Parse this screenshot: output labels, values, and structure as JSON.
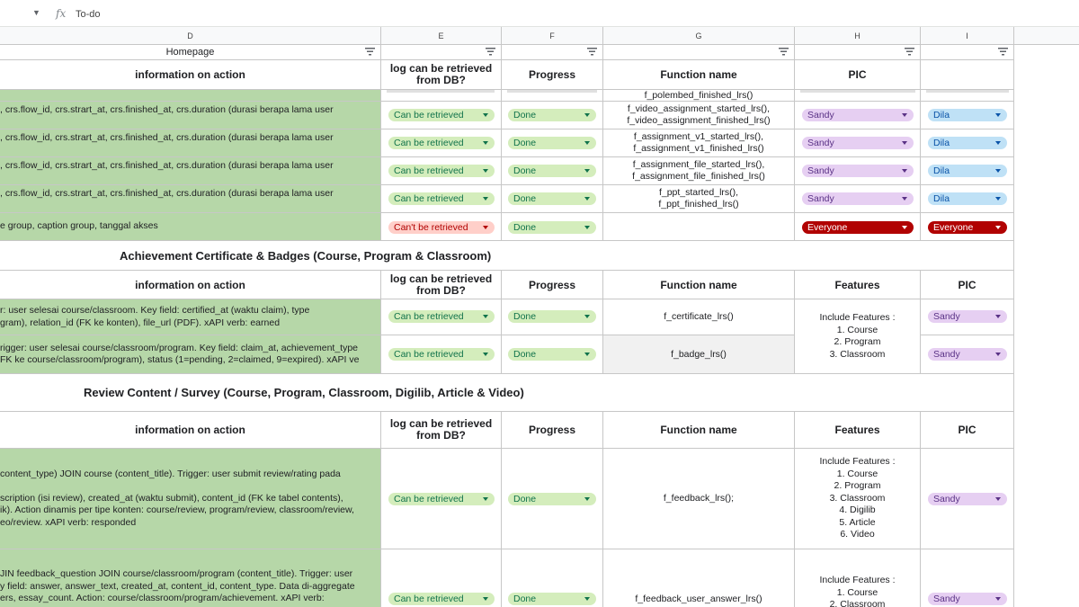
{
  "formula_bar": {
    "fx": "fx",
    "value": "To-do"
  },
  "columns": [
    "D",
    "E",
    "F",
    "G",
    "H",
    "I"
  ],
  "section1": {
    "title": "Homepage",
    "headers": {
      "info": "information on action",
      "log": "log can be retrieved from DB?",
      "progress": "Progress",
      "function": "Function name",
      "pic": "PIC"
    },
    "partial_function": "f_polembed_finished_lrs()",
    "rows": [
      {
        "info": ", crs.flow_id,  crs.strart_at, crs.finished_at,  crs.duration (durasi berapa lama user",
        "log": "Can be retrieved",
        "progress": "Done",
        "func1": "f_video_assignment_started_lrs(),",
        "func2": "f_video_assignment_finished_lrs()",
        "pic1": "Sandy",
        "pic2": "Dila"
      },
      {
        "info": ", crs.flow_id,  crs.strart_at, crs.finished_at,  crs.duration (durasi berapa lama user",
        "log": "Can be retrieved",
        "progress": "Done",
        "func1": "f_assignment_v1_started_lrs(),",
        "func2": "f_assignment_v1_finished_lrs()",
        "pic1": "Sandy",
        "pic2": "Dila"
      },
      {
        "info": ", crs.flow_id,  crs.strart_at, crs.finished_at,  crs.duration (durasi berapa lama user",
        "log": "Can be retrieved",
        "progress": "Done",
        "func1": "f_assignment_file_started_lrs(),",
        "func2": "f_assignment_file_finished_lrs()",
        "pic1": "Sandy",
        "pic2": "Dila"
      },
      {
        "info": ", crs.flow_id,  crs.strart_at, crs.finished_at,  crs.duration (durasi berapa lama user",
        "log": "Can be retrieved",
        "progress": "Done",
        "func1": "f_ppt_started_lrs(),",
        "func2": "f_ppt_finished_lrs()",
        "pic1": "Sandy",
        "pic2": "Dila"
      },
      {
        "info": "e group, caption group, tanggal akses",
        "log": "Can't be retrieved",
        "progress": "Done",
        "func1": "",
        "func2": "",
        "pic1": "Everyone",
        "pic2": "Everyone"
      }
    ]
  },
  "section2": {
    "title": "Achievement Certificate & Badges (Course, Program & Classroom)",
    "headers": {
      "info": "information on action",
      "log": "log can be retrieved from DB?",
      "progress": "Progress",
      "function": "Function name",
      "features": "Features",
      "pic": "PIC"
    },
    "features_text": [
      "Include Features :",
      "1. Course",
      "2. Program",
      "3. Classroom"
    ],
    "rows": [
      {
        "info1": "r: user selesai course/classroom. Key field: certified_at (waktu claim), type",
        "info2": "gram), relation_id (FK ke konten), file_url (PDF). xAPI verb: earned",
        "log": "Can be retrieved",
        "progress": "Done",
        "func": "f_certificate_lrs()",
        "pic": "Sandy"
      },
      {
        "info1": "rigger: user selesai course/classroom/program. Key field: claim_at, achievement_type",
        "info2": "FK ke course/classroom/program), status (1=pending, 2=claimed, 9=expired). xAPI ve",
        "log": "Can be retrieved",
        "progress": "Done",
        "func": "f_badge_lrs()",
        "pic": "Sandy"
      }
    ]
  },
  "section3": {
    "title": "Review Content / Survey (Course, Program, Classroom, Digilib, Article & Video)",
    "headers": {
      "info": "information on action",
      "log": "log can be retrieved from DB?",
      "progress": "Progress",
      "function": "Function name",
      "features": "Features",
      "pic": "PIC"
    },
    "rows": [
      {
        "info": [
          "content_type) JOIN course (content_title). Trigger: user submit review/rating pada",
          "",
          "scription (isi review), created_at (waktu submit), content_id (FK ke tabel contents),",
          "ik). Action dinamis per tipe konten: course/review, program/review, classroom/review,",
          "eo/review. xAPI verb: responded"
        ],
        "log": "Can be retrieved",
        "progress": "Done",
        "func": "f_feedback_lrs();",
        "features": [
          "Include Features :",
          "1. Course",
          "2. Program",
          "3. Classroom",
          "4. Digilib",
          "5. Article",
          "6. Video"
        ],
        "pic": "Sandy"
      },
      {
        "info": [
          "JIN feedback_question JOIN course/classroom/program (content_title). Trigger: user",
          "y field: answer, answer_text, created_at, content_id, content_type. Data di-aggregate",
          "ers, essay_count. Action: course/classroom/program/achievement. xAPI verb:"
        ],
        "log": "Can be retrieved",
        "progress": "Done",
        "func": "f_feedback_user_answer_lrs()",
        "features": [
          "Include Features :",
          "1. Course",
          "2. Classroom"
        ],
        "pic": "Sandy"
      }
    ]
  }
}
